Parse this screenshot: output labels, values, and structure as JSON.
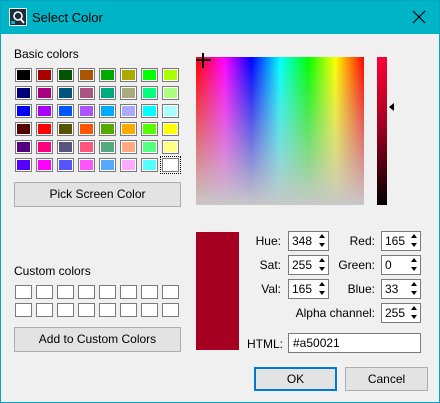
{
  "window": {
    "title": "Select Color",
    "app_icon": "color-picker-app-icon",
    "close_icon": "close-icon"
  },
  "basic_colors": {
    "label": "Basic colors",
    "swatches": [
      [
        "#000000",
        "#aa0000",
        "#005500",
        "#aa5500",
        "#00aa00",
        "#aaaa00",
        "#00ff00",
        "#aaff00"
      ],
      [
        "#00007f",
        "#aa007f",
        "#00557f",
        "#aa557f",
        "#00aa7f",
        "#aaaa7f",
        "#00ff7f",
        "#aaff7f"
      ],
      [
        "#0000ff",
        "#aa00ff",
        "#0055ff",
        "#aa55ff",
        "#00aaff",
        "#aaaaff",
        "#00ffff",
        "#aaffff"
      ],
      [
        "#550000",
        "#ff0000",
        "#555500",
        "#ff5500",
        "#55aa00",
        "#ffaa00",
        "#55ff00",
        "#ffff00"
      ],
      [
        "#55007f",
        "#ff007f",
        "#55557f",
        "#ff557f",
        "#55aa7f",
        "#ffaa7f",
        "#55ff7f",
        "#ffff7f"
      ],
      [
        "#5500ff",
        "#ff00ff",
        "#5555ff",
        "#ff55ff",
        "#55aaff",
        "#ffaaff",
        "#55ffff",
        "#ffffff"
      ]
    ],
    "selected": "#ffffff"
  },
  "pick_screen_color_label": "Pick Screen Color",
  "custom_colors": {
    "label": "Custom colors",
    "rows": 2,
    "cols": 8
  },
  "add_to_custom_colors_label": "Add to Custom Colors",
  "current_color": "#a50021",
  "fields": {
    "hue": {
      "label": "Hue:",
      "value": "348"
    },
    "sat": {
      "label": "Sat:",
      "value": "255"
    },
    "val": {
      "label": "Val:",
      "value": "165"
    },
    "red": {
      "label": "Red:",
      "value": "165"
    },
    "green": {
      "label": "Green:",
      "value": "0"
    },
    "blue": {
      "label": "Blue:",
      "value": "33"
    },
    "alpha": {
      "label": "Alpha channel:",
      "value": "255"
    }
  },
  "html_field": {
    "label": "HTML:",
    "value": "#a50021"
  },
  "buttons": {
    "ok": "OK",
    "cancel": "Cancel"
  }
}
